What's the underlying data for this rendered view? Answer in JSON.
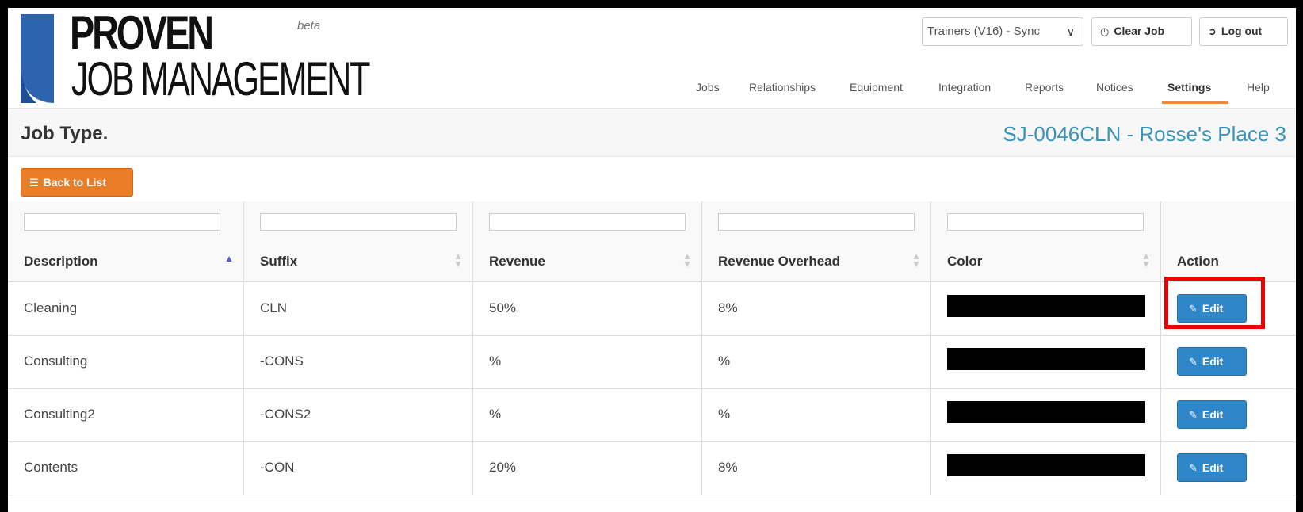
{
  "header": {
    "logo_line1": "PROVEN",
    "logo_line2": "JOB MANAGEMENT",
    "beta": "beta",
    "company_select": "Trainers (V16) - Sync",
    "clear_job": "Clear Job",
    "log_out": "Log out",
    "nav": [
      "Jobs",
      "Relationships",
      "Equipment",
      "Integration",
      "Reports",
      "Notices",
      "Settings",
      "Help"
    ],
    "active_nav": "Settings"
  },
  "page": {
    "title": "Job Type.",
    "job_ref": "SJ-0046CLN - Rosse's Place 3",
    "back_to_list": "Back to List"
  },
  "table": {
    "columns": [
      "Description",
      "Suffix",
      "Revenue",
      "Revenue Overhead",
      "Color",
      "Action"
    ],
    "sort_column": "Description",
    "rows": [
      {
        "description": "Cleaning",
        "suffix": "CLN",
        "revenue": "50%",
        "revenue_overhead": "8%",
        "color": "#000000",
        "action": "Edit"
      },
      {
        "description": "Consulting",
        "suffix": "-CONS",
        "revenue": "%",
        "revenue_overhead": "%",
        "color": "#000000",
        "action": "Edit"
      },
      {
        "description": "Consulting2",
        "suffix": "-CONS2",
        "revenue": "%",
        "revenue_overhead": "%",
        "color": "#000000",
        "action": "Edit"
      },
      {
        "description": "Contents",
        "suffix": "-CON",
        "revenue": "20%",
        "revenue_overhead": "8%",
        "color": "#000000",
        "action": "Edit"
      }
    ]
  },
  "colors": {
    "accent_orange": "#ec7d28",
    "edit_blue": "#2f86c8",
    "job_ref_blue": "#3a93b8",
    "highlight_red": "#f20000"
  }
}
